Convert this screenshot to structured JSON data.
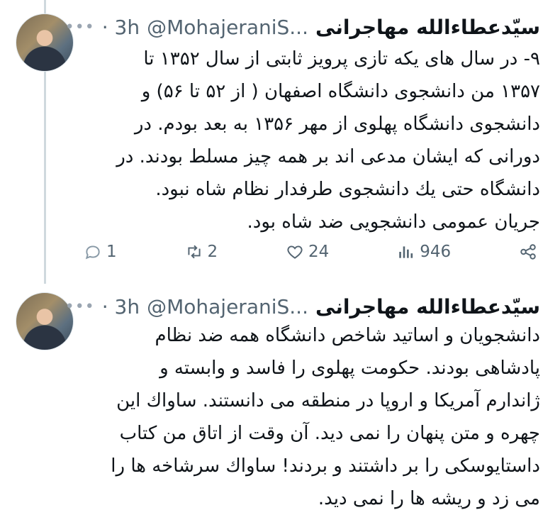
{
  "tweets": [
    {
      "name": "سیّدعطاءالله مهاجرانی",
      "handle": "@MohajeraniS...",
      "time": "· 3h",
      "lines": [
        "۹- در سال های یکه تازی پرویز ثابتی از سال ۱۳۵۲ تا",
        "۱۳۵۷ من دانشجوی دانشگاه اصفهان ( از ۵۲ تا ۵۶) و",
        "دانشجوی دانشگاه پهلوی از مهر ۱۳۵۶ به بعد بودم. در",
        "دورانی که ایشان مدعی اند بر همه چیز مسلط بودند. در",
        "دانشگاه حتی یك دانشجوی طرفدار نظام شاه نبود.",
        "جریان عمومی دانشجویی ضد شاه بود."
      ],
      "stats": {
        "replies": "1",
        "reposts": "2",
        "likes": "24",
        "views": "946"
      }
    },
    {
      "name": "سیّدعطاءالله مهاجرانی",
      "handle": "@MohajeraniS...",
      "time": "· 3h",
      "lines": [
        "دانشجویان و اساتید شاخص دانشگاه همه ضد نظام",
        "پادشاهی بودند. حکومت پهلوی را فاسد و وابسته و",
        "ژاندارم آمریکا و اروپا در منطقه می دانستند. ساواك این",
        "چهره و متن پنهان را نمی دید. آن وقت از اتاق من کتاب",
        "داستایوسکی را بر داشتند و بردند! ساواك سرشاخه ها را",
        "می زد و ریشه ها را نمی دید."
      ]
    }
  ],
  "icons": {
    "reply": "reply-icon",
    "repost": "repost-icon",
    "like": "heart-icon",
    "views": "views-icon",
    "share": "share-icon",
    "more": "more-icon"
  },
  "colors": {
    "text": "#0f1419",
    "muted": "#536471",
    "thread_line": "#cfd9de"
  }
}
